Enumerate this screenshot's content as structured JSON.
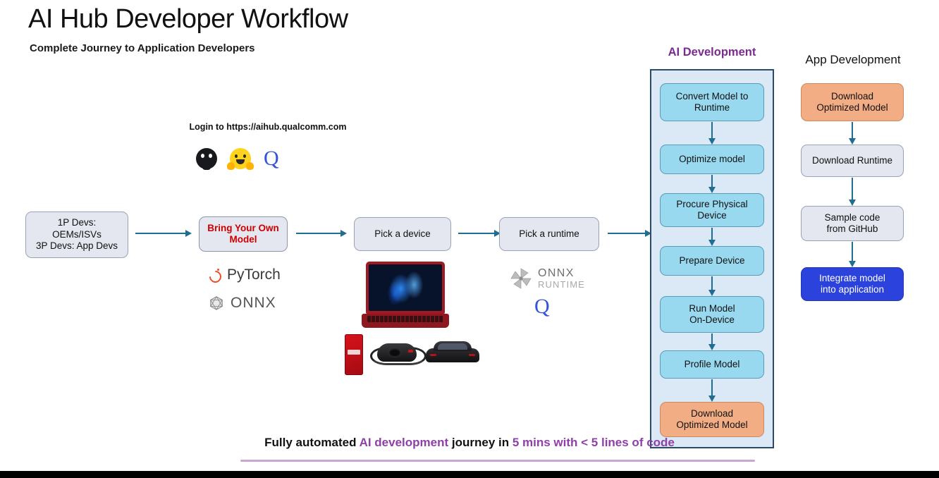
{
  "header": {
    "title": "AI Hub Developer Workflow",
    "subtitle": "Complete Journey to Application Developers"
  },
  "login": {
    "label": "Login to https://aihub.qualcomm.com",
    "icons": [
      "github-icon",
      "hugging-face-icon",
      "qualcomm-q-icon"
    ]
  },
  "flow": {
    "personas": "1P Devs:\nOEMs/ISVs\n3P Devs: App Devs",
    "byom": "Bring Your Own\nModel",
    "pick_device": "Pick a device",
    "pick_runtime": "Pick a runtime"
  },
  "model_logos": {
    "pytorch": "PyTorch",
    "onnx": "ONNX"
  },
  "runtime_logos": {
    "onnx_runtime_line1": "ONNX",
    "onnx_runtime_line2": "RUNTIME",
    "qualcomm": "Q"
  },
  "ai_development": {
    "title": "AI Development",
    "steps": [
      {
        "label": "Convert Model to\nRuntime",
        "style": "cyan"
      },
      {
        "label": "Optimize model",
        "style": "cyan"
      },
      {
        "label": "Procure Physical\nDevice",
        "style": "cyan"
      },
      {
        "label": "Prepare Device",
        "style": "cyan"
      },
      {
        "label": "Run Model\nOn-Device",
        "style": "cyan"
      },
      {
        "label": "Profile Model",
        "style": "cyan"
      },
      {
        "label": "Download\nOptimized Model",
        "style": "orange"
      }
    ]
  },
  "app_development": {
    "title": "App Development",
    "steps": [
      {
        "label": "Download\nOptimized Model",
        "style": "orange"
      },
      {
        "label": "Download Runtime",
        "style": "grey"
      },
      {
        "label": "Sample code\nfrom GitHub",
        "style": "grey"
      },
      {
        "label": "Integrate model\ninto application",
        "style": "bluefill"
      }
    ]
  },
  "footer": {
    "part1": "Fully automated ",
    "highlight1": "AI development",
    "part2": " journey in ",
    "highlight2": "5 mins with < 5 lines of code"
  },
  "colors": {
    "accent_purple": "#8e3fa8",
    "title_purple": "#7b2a8f",
    "arrow_blue": "#1f6d91",
    "cyan_box": "#98d9f0",
    "orange_box": "#f2ad84",
    "blue_box": "#2c42dd",
    "grey_box": "#e4e7ef",
    "panel_bg": "#dbe8f6",
    "panel_border": "#2b4a66",
    "byom_red": "#cc0000"
  }
}
